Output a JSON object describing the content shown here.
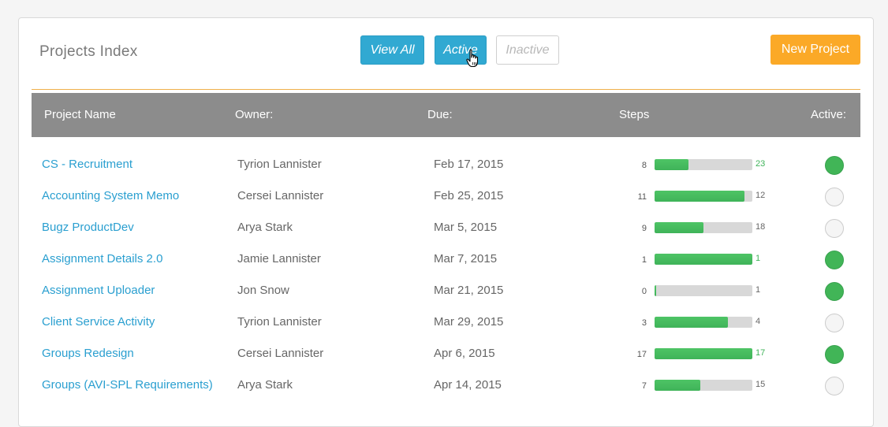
{
  "header": {
    "title": "Projects Index",
    "filters": {
      "view_all_label": "View All",
      "active_label": "Active",
      "inactive_label": "Inactive"
    },
    "new_project_label": "New Project"
  },
  "table": {
    "columns": {
      "name": "Project Name",
      "owner": "Owner:",
      "due": "Due:",
      "steps": "Steps",
      "active": "Active:"
    },
    "rows": [
      {
        "name": "CS - Recruitment",
        "owner": "Tyrion Lannister",
        "due": "Feb 17, 2015",
        "steps_done": "8",
        "steps_total": "23",
        "progress": 0.35,
        "active": true
      },
      {
        "name": "Accounting System Memo",
        "owner": "Cersei Lannister",
        "due": "Feb 25, 2015",
        "steps_done": "11",
        "steps_total": "12",
        "progress": 0.92,
        "active": false
      },
      {
        "name": "Bugz ProductDev",
        "owner": "Arya Stark",
        "due": "Mar 5, 2015",
        "steps_done": "9",
        "steps_total": "18",
        "progress": 0.5,
        "active": false
      },
      {
        "name": "Assignment Details 2.0",
        "owner": "Jamie Lannister",
        "due": "Mar 7, 2015",
        "steps_done": "1",
        "steps_total": "1",
        "progress": 1.0,
        "active": true
      },
      {
        "name": "Assignment Uploader",
        "owner": "Jon Snow",
        "due": "Mar 21, 2015",
        "steps_done": "0",
        "steps_total": "1",
        "progress": 0.0,
        "active": true
      },
      {
        "name": "Client Service Activity",
        "owner": "Tyrion Lannister",
        "due": "Mar 29, 2015",
        "steps_done": "3",
        "steps_total": "4",
        "progress": 0.75,
        "active": false
      },
      {
        "name": "Groups Redesign",
        "owner": "Cersei Lannister",
        "due": "Apr 6, 2015",
        "steps_done": "17",
        "steps_total": "17",
        "progress": 1.0,
        "active": true
      },
      {
        "name": "Groups (AVI-SPL Requirements)",
        "owner": "Arya Stark",
        "due": "Apr 14, 2015",
        "steps_done": "7",
        "steps_total": "15",
        "progress": 0.47,
        "active": false
      }
    ]
  },
  "colors": {
    "accent_blue": "#31a9d2",
    "new_button": "#fba927",
    "progress_green": "#41b557",
    "total_complete": "#3fb359",
    "total_incomplete": "#666666"
  }
}
